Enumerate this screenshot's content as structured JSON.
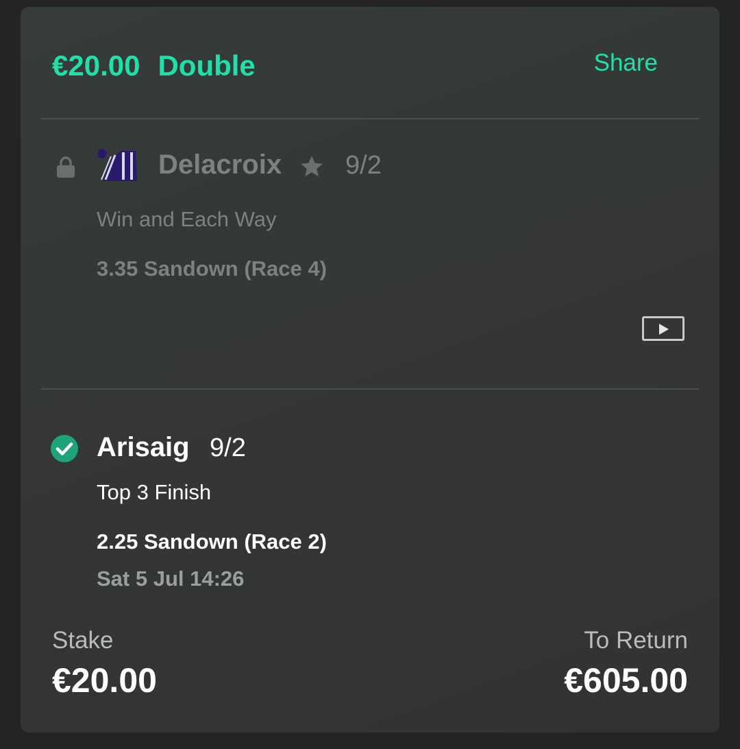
{
  "header": {
    "stake_amount": "€20.00",
    "bet_type": "Double",
    "share_label": "Share"
  },
  "legs": [
    {
      "status": "locked",
      "selection": "Delacroix",
      "favourite_icon": "star-icon",
      "odds": "9/2",
      "market": "Win and Each Way",
      "event": "3.35 Sandown (Race 4)",
      "silks_colors": [
        "#2a1a6e",
        "#d8d8e8"
      ],
      "video_icon": "play-icon"
    },
    {
      "status": "won",
      "selection": "Arisaig",
      "odds": "9/2",
      "market": "Top 3 Finish",
      "event": "2.25 Sandown (Race 2)",
      "datetime": "Sat 5 Jul 14:26"
    }
  ],
  "footer": {
    "stake_label": "Stake",
    "stake_value": "€20.00",
    "return_label": "To Return",
    "return_value": "€605.00"
  },
  "colors": {
    "accent": "#1fe0a8",
    "win_check": "#1fa37a",
    "muted_text": "#7d817f"
  }
}
